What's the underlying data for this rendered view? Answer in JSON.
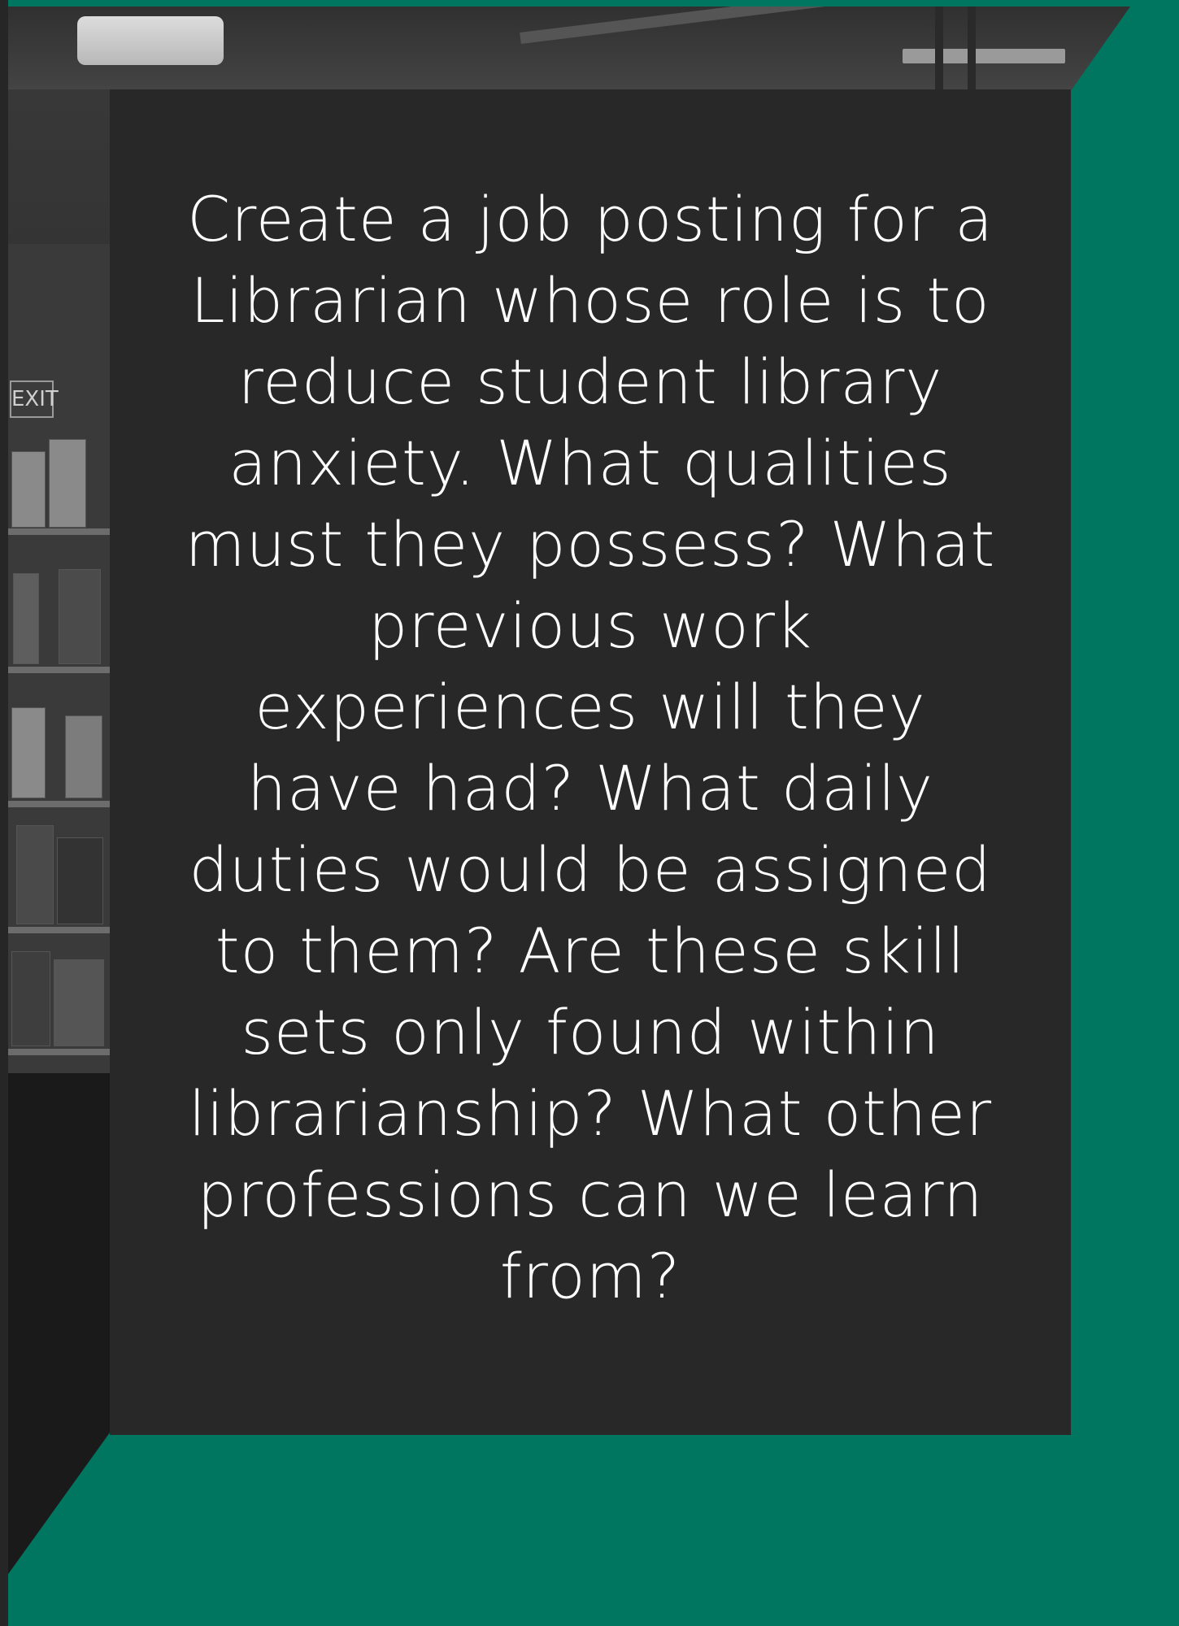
{
  "background": {
    "accent_color": "#00755f",
    "photo_description_icon": "library-bookshelf-photo"
  },
  "card": {
    "background_color": "#282828",
    "prompt_text": "Create a job posting for a Librarian whose role is to reduce student library anxiety. What qualities must they possess? What previous work experiences will they have had? What daily duties would be assigned to them? Are these skill sets only found within librarianship? What other professions can we learn from?"
  },
  "photo": {
    "exit_sign_text": "EXIT"
  }
}
